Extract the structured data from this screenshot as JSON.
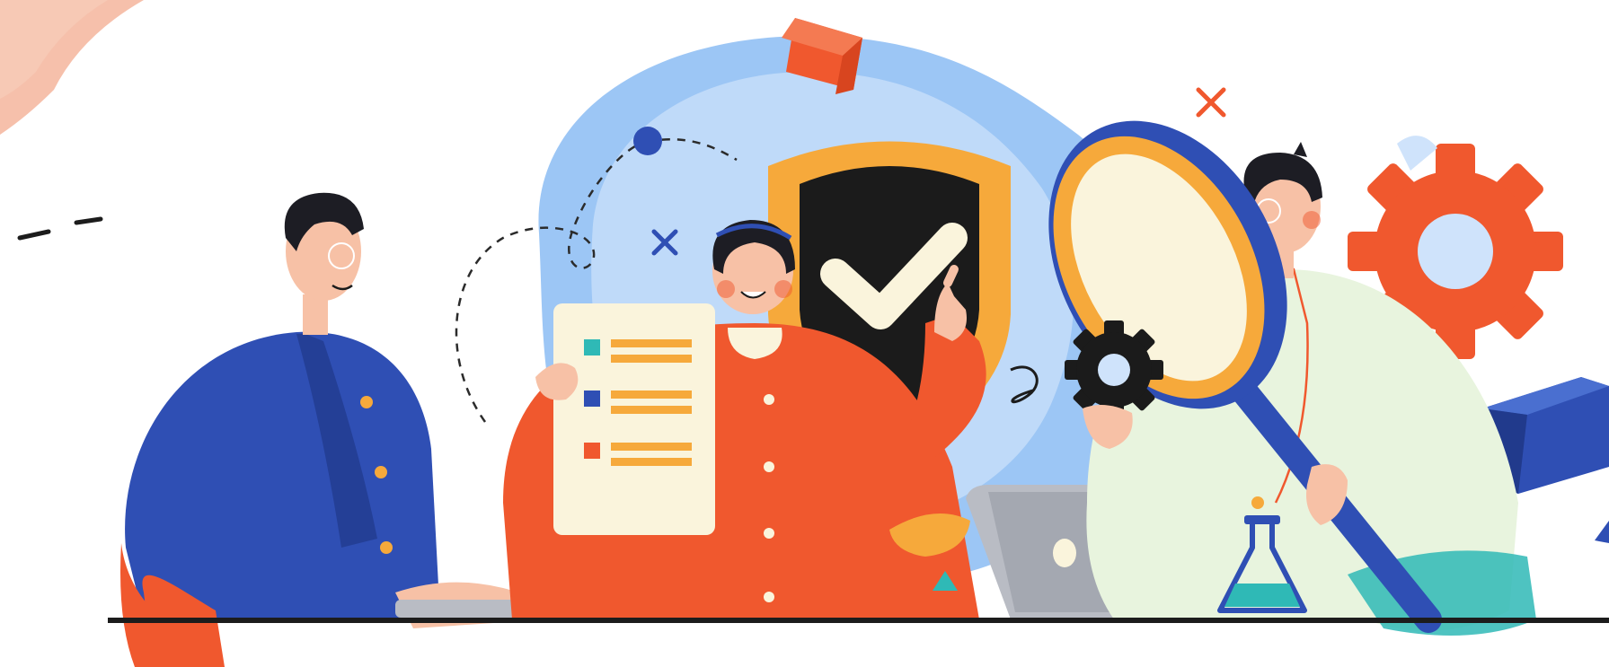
{
  "illustration": {
    "kind": "flat vector illustration",
    "colors": {
      "background": "#ffffff",
      "blob_blue": "#9cc6f5",
      "blob_blue_light": "#cfe3fb",
      "blue_dark": "#2f4fb4",
      "orange_red": "#f0582e",
      "orange": "#f6a93b",
      "cream": "#faf4dc",
      "skin": "#f7c1a6",
      "hair": "#1d1d24",
      "black": "#1b1b1b",
      "green_white": "#e8f4de",
      "teal": "#2fb9b6",
      "laptop_grey": "#b9bcc4",
      "ground": "#1c1c1c",
      "peach": "#f5b59c"
    },
    "icons": [
      "shield-check-icon",
      "magnifying-glass-icon",
      "gear-icon",
      "small-gear-icon",
      "checklist-icon",
      "cube-icon",
      "laptop-icon",
      "flask-icon",
      "cross-icon",
      "triangle-icon"
    ],
    "figures": [
      "man-in-blue",
      "woman-in-red",
      "man-in-cream"
    ]
  }
}
